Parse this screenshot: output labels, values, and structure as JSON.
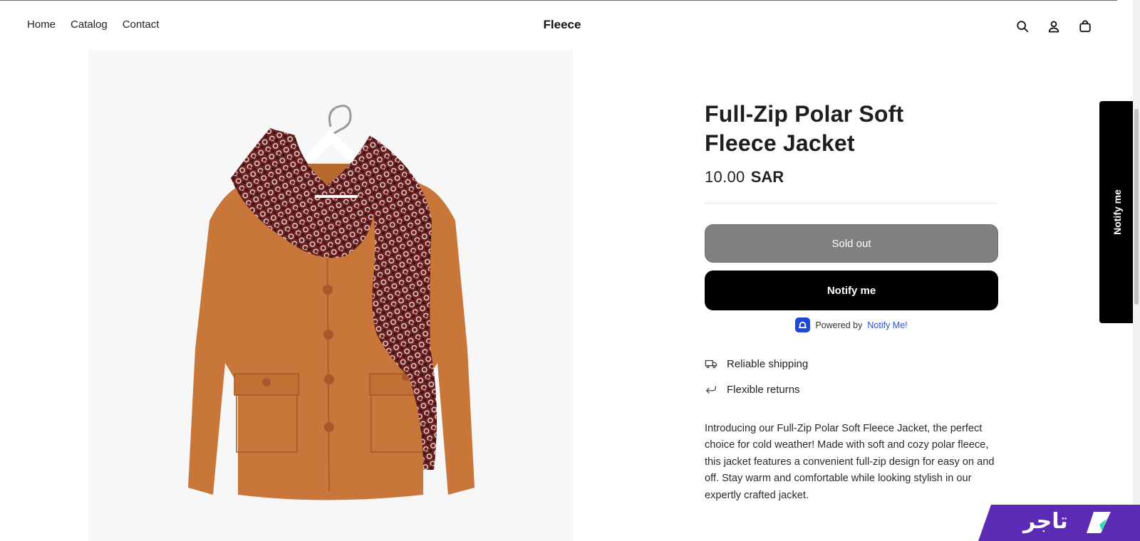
{
  "header": {
    "nav": [
      "Home",
      "Catalog",
      "Contact"
    ],
    "brand": "Fleece",
    "icons": [
      "search-icon",
      "account-icon",
      "cart-icon"
    ]
  },
  "product": {
    "title": "Full-Zip Polar Soft Fleece Jacket",
    "price_amount": "10.00",
    "price_currency": "SAR",
    "sold_out_label": "Sold out",
    "notify_label": "Notify me",
    "powered_by": "Powered by",
    "powered_link": "Notify Me!",
    "features": [
      {
        "icon": "truck-icon",
        "label": "Reliable shipping"
      },
      {
        "icon": "return-arrow-icon",
        "label": "Flexible returns"
      }
    ],
    "description": "Introducing our Full-Zip Polar Soft Fleece Jacket, the perfect choice for cold weather! Made with soft and cozy polar fleece, this jacket features a convenient full-zip design for easy on and off. Stay warm and comfortable while looking stylish in our expertly crafted jacket."
  },
  "side_tab": {
    "label": "Notify me"
  },
  "tajer_badge": {
    "label": "تاجر"
  },
  "colors": {
    "sold_out_bg": "#808080",
    "notify_bg": "#000000",
    "link_blue": "#2c4fd6",
    "badge_purple": "#5b2bb5",
    "badge_teal": "#3dd9b0"
  }
}
